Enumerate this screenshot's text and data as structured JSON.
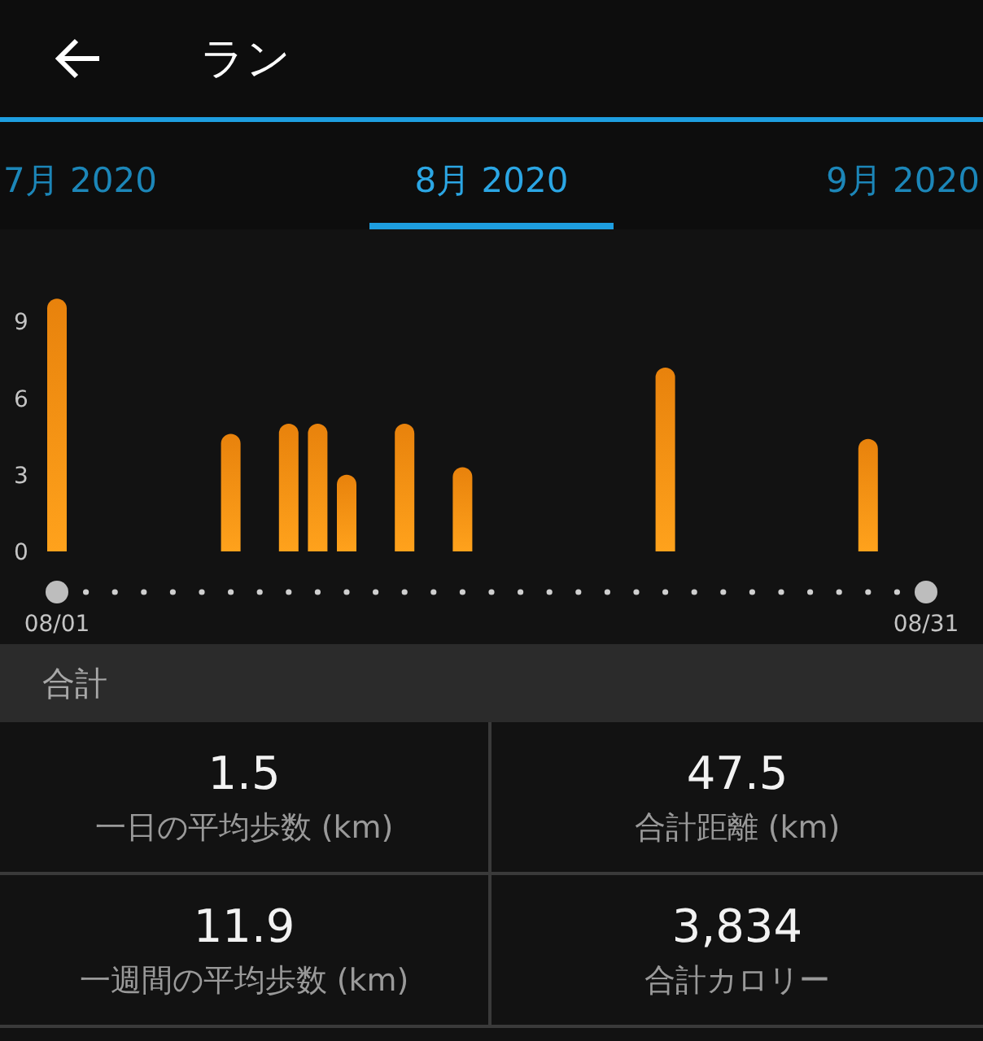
{
  "header": {
    "title": "ラン"
  },
  "tabs": [
    {
      "label": "7月 2020",
      "selected": false
    },
    {
      "label": "8月 2020",
      "selected": true
    },
    {
      "label": "9月 2020",
      "selected": false
    }
  ],
  "chart": {
    "chart_data": {
      "type": "bar",
      "categories": [
        "08/01",
        null,
        null,
        null,
        null,
        null,
        null,
        null,
        null,
        null,
        null,
        null,
        null,
        null,
        null,
        null,
        null,
        null,
        null,
        null,
        null,
        null,
        null,
        null,
        null,
        null,
        null,
        null,
        null,
        null,
        "08/31"
      ],
      "values": [
        9.9,
        null,
        null,
        null,
        null,
        null,
        4.6,
        null,
        5.0,
        5.0,
        3.0,
        null,
        5.0,
        null,
        3.3,
        null,
        null,
        null,
        null,
        null,
        null,
        7.2,
        null,
        null,
        null,
        null,
        null,
        null,
        4.4,
        null,
        null
      ],
      "ylim": [
        0,
        10
      ],
      "yticks": [
        0,
        3,
        6,
        9
      ]
    }
  },
  "summary": {
    "title": "合計",
    "stats": [
      {
        "value": "1.5",
        "label": "一日の平均歩数 (km)"
      },
      {
        "value": "47.5",
        "label": "合計距離 (km)"
      },
      {
        "value": "11.9",
        "label": "一週間の平均歩数 (km)"
      },
      {
        "value": "3,834",
        "label": "合計カロリー"
      }
    ]
  }
}
